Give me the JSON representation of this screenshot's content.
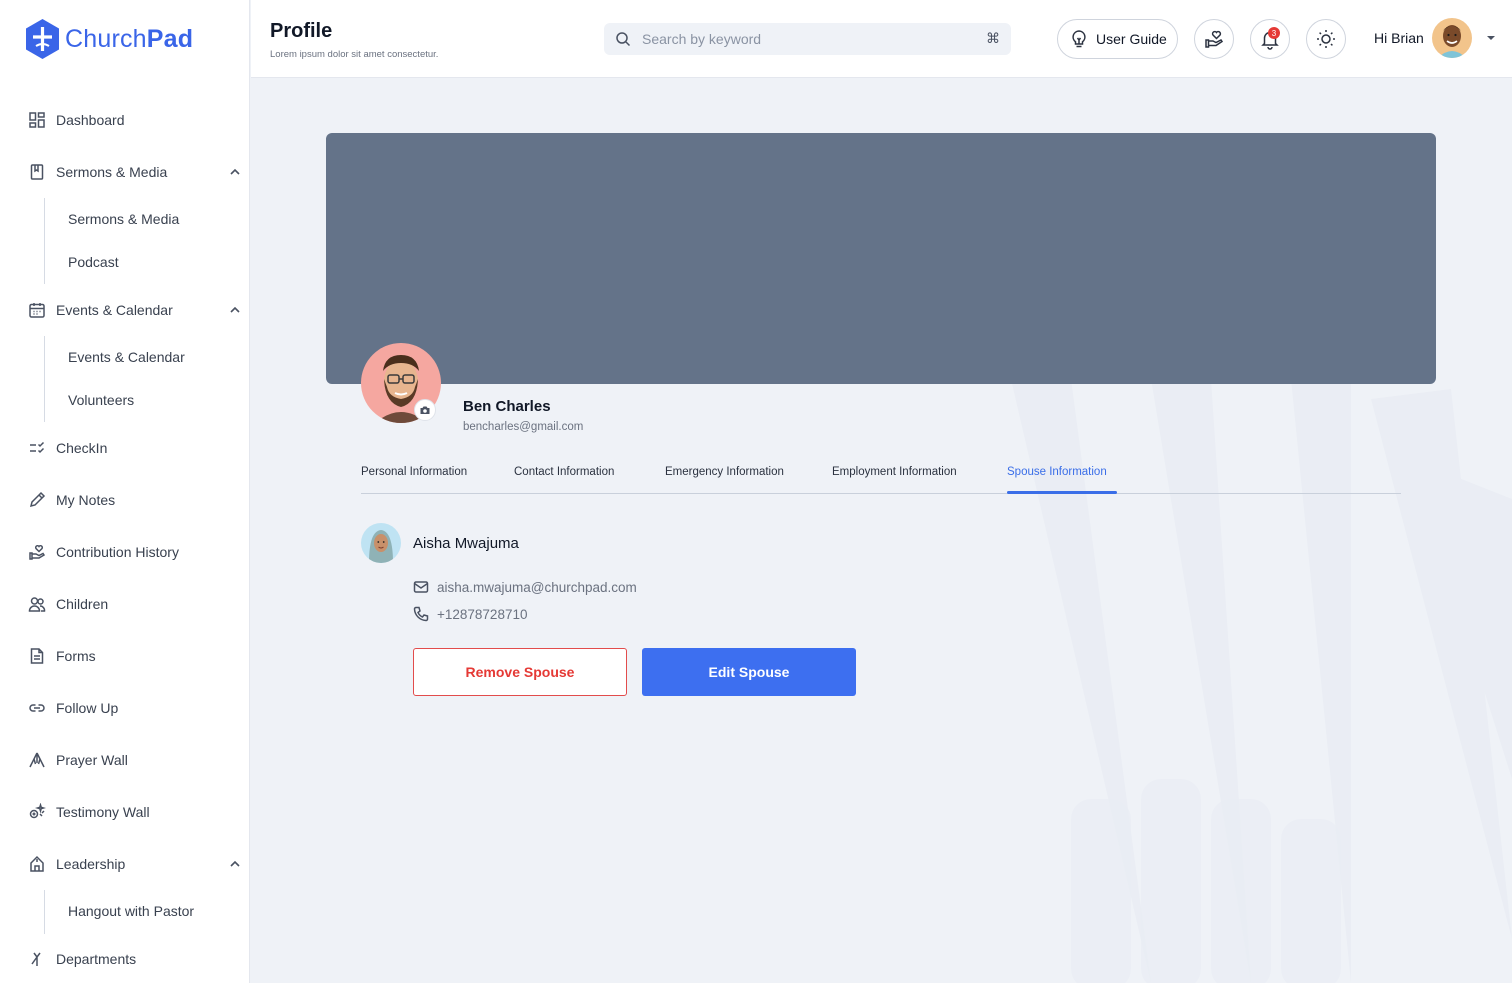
{
  "app": {
    "brand_prefix": "Church",
    "brand_suffix": "Pad",
    "accent_color": "#3a65e8"
  },
  "sidebar": {
    "items": [
      {
        "label": "Dashboard",
        "icon": "dashboard-icon"
      },
      {
        "label": "Sermons & Media",
        "icon": "book-icon",
        "expanded": true,
        "children": [
          "Sermons & Media",
          "Podcast"
        ]
      },
      {
        "label": "Events & Calendar",
        "icon": "calendar-icon",
        "expanded": true,
        "children": [
          "Events & Calendar",
          "Volunteers"
        ]
      },
      {
        "label": "CheckIn",
        "icon": "checklist-icon"
      },
      {
        "label": "My Notes",
        "icon": "pencil-icon"
      },
      {
        "label": "Contribution History",
        "icon": "hand-heart-icon"
      },
      {
        "label": "Children",
        "icon": "users-icon"
      },
      {
        "label": "Forms",
        "icon": "document-icon"
      },
      {
        "label": "Follow Up",
        "icon": "link-icon"
      },
      {
        "label": "Prayer Wall",
        "icon": "praying-hands-icon"
      },
      {
        "label": "Testimony Wall",
        "icon": "sparkle-icon"
      },
      {
        "label": "Leadership",
        "icon": "org-chart-icon",
        "expanded": true,
        "children": [
          "Hangout with Pastor"
        ]
      },
      {
        "label": "Departments",
        "icon": "branch-icon"
      }
    ]
  },
  "header": {
    "title": "Profile",
    "subtitle": "Lorem ipsum dolor sit amet consectetur.",
    "search_placeholder": "Search by keyword",
    "search_shortcut": "⌘",
    "user_guide_label": "User Guide",
    "notification_count": "3",
    "greeting": "Hi Brian"
  },
  "profile": {
    "name": "Ben Charles",
    "email": "bencharles@gmail.com",
    "cover_color": "#647389"
  },
  "tabs": [
    {
      "label": "Personal Information",
      "active": false
    },
    {
      "label": "Contact Information",
      "active": false
    },
    {
      "label": "Emergency Information",
      "active": false
    },
    {
      "label": "Employment Information",
      "active": false
    },
    {
      "label": "Spouse Information",
      "active": true
    }
  ],
  "spouse": {
    "name": "Aisha Mwajuma",
    "email": "aisha.mwajuma@churchpad.com",
    "phone": "+12878728710",
    "remove_label": "Remove Spouse",
    "edit_label": "Edit Spouse"
  }
}
